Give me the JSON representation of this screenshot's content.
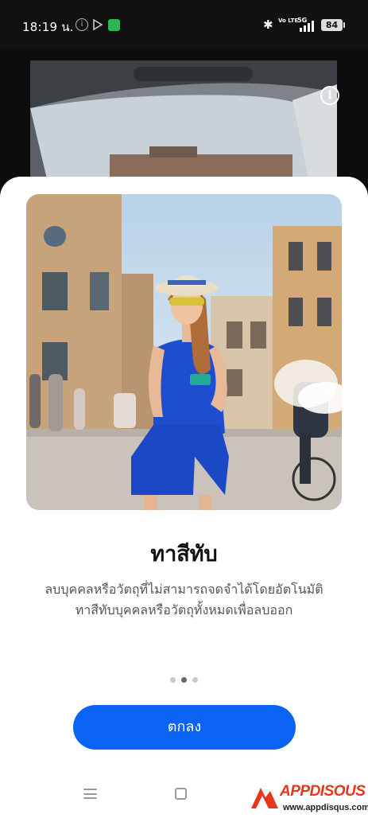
{
  "status_bar": {
    "time": "18:19 น.",
    "volte": "Vo LTE",
    "network": "5G",
    "battery": "84"
  },
  "intro": {
    "title": "ทาสีทับ",
    "description_line1": "ลบบุคคลหรือวัตถุที่ไม่สามารถจดจำได้โดยอัตโนมัติ",
    "description_line2": "ทาสีทับบุคคลหรือวัตถุทั้งหมดเพื่อลบออก",
    "page_count": 3,
    "active_page": 2,
    "confirm_label": "ตกลง"
  },
  "watermark": {
    "brand": "APPDISOUS",
    "url": "www.appdisqus.com"
  },
  "colors": {
    "accent": "#0a63f2",
    "watermark": "#e8361c"
  }
}
